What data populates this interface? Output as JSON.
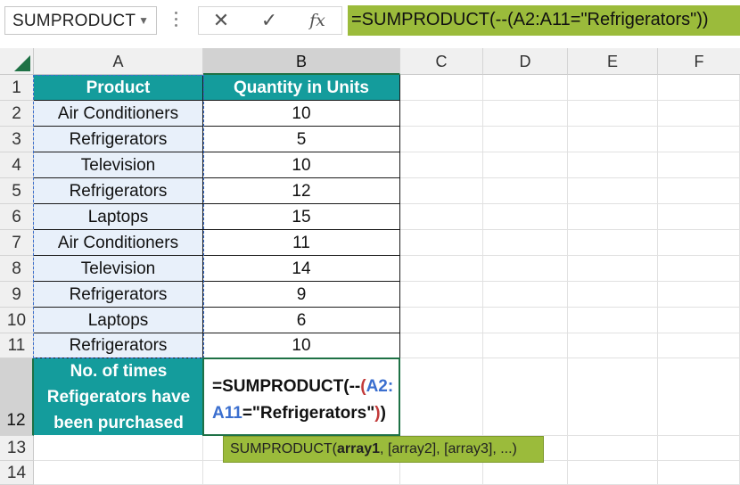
{
  "name_box": {
    "value": "SUMPRODUCT"
  },
  "formula_bar": {
    "cancel_glyph": "✕",
    "enter_glyph": "✓",
    "fx_label": "fx",
    "formula": "=SUMPRODUCT(--(A2:A11=\"Refrigerators\"))"
  },
  "columns": [
    "A",
    "B",
    "C",
    "D",
    "E",
    "F"
  ],
  "rows": [
    "1",
    "2",
    "3",
    "4",
    "5",
    "6",
    "7",
    "8",
    "9",
    "10",
    "11",
    "12",
    "13",
    "14"
  ],
  "table": {
    "headers": [
      "Product",
      "Quantity in Units"
    ],
    "data": [
      [
        "Air Conditioners",
        "10"
      ],
      [
        "Refrigerators",
        "5"
      ],
      [
        "Television",
        "10"
      ],
      [
        "Refrigerators",
        "12"
      ],
      [
        "Laptops",
        "15"
      ],
      [
        "Air Conditioners",
        "11"
      ],
      [
        "Television",
        "14"
      ],
      [
        "Refrigerators",
        "9"
      ],
      [
        "Laptops",
        "6"
      ],
      [
        "Refrigerators",
        "10"
      ]
    ]
  },
  "row12": {
    "label_lines": [
      "No. of times",
      "Refigerators have",
      "been purchased"
    ],
    "formula_parts": {
      "p1": "=SUMPRODUCT(--",
      "p2": "(",
      "p3": "A2:",
      "p4": "A11",
      "p5": "=\"Refrigerators\"",
      "p6": ")",
      "p7": ")"
    }
  },
  "tooltip": {
    "fn": "SUMPRODUCT(",
    "arg1": "array1",
    "rest": ", [array2], [array3], ...)"
  },
  "colors": {
    "teal_header": "#149c9c",
    "formula_green": "#9bbb3b",
    "excel_green": "#1e7145",
    "ref_blue": "#3b6fcf",
    "paren_red": "#c23a3a"
  }
}
